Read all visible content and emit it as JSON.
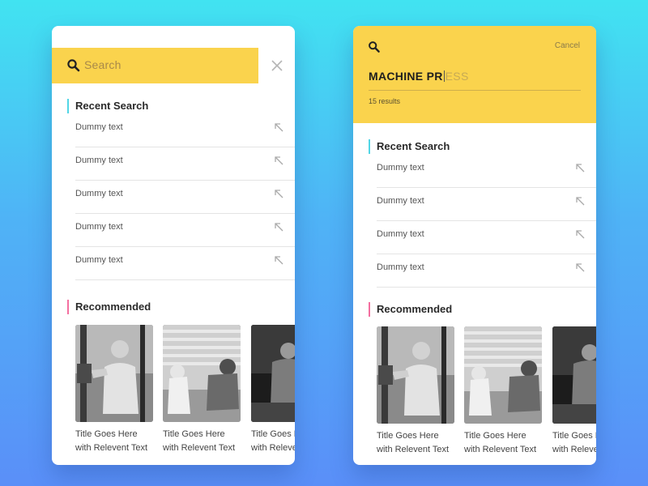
{
  "left": {
    "search_placeholder": "Search",
    "recent_title": "Recent Search",
    "recent_items": [
      "Dummy text",
      "Dummy text",
      "Dummy text",
      "Dummy text",
      "Dummy text"
    ],
    "recommended_title": "Recommended",
    "recommended": [
      {
        "line1": "Title Goes Here",
        "line2": "with Relevent Text"
      },
      {
        "line1": "Title Goes Here",
        "line2": "with Relevent Text"
      },
      {
        "line1": "Title Goes Here",
        "line2": "with Relevent Text"
      }
    ]
  },
  "right": {
    "cancel_label": "Cancel",
    "query_typed": "MACHINE PR",
    "query_suggestion": "ESS",
    "results_count": "15 results",
    "recent_title": "Recent Search",
    "recent_items": [
      "Dummy text",
      "Dummy text",
      "Dummy text",
      "Dummy text"
    ],
    "recommended_title": "Recommended",
    "recommended": [
      {
        "line1": "Title Goes Here",
        "line2": "with Relevent Text"
      },
      {
        "line1": "Title Goes Here",
        "line2": "with Relevent Text"
      },
      {
        "line1": "Title Goes Here",
        "line2": "with Relevent Text"
      }
    ]
  },
  "icons": {
    "search": "search-icon",
    "close": "close-icon",
    "recent_arrow": "arrow-up-left-icon"
  },
  "colors": {
    "accent_yellow": "#fad34d",
    "recent_accent": "#52d6e6",
    "recommended_accent": "#f46fa0"
  }
}
